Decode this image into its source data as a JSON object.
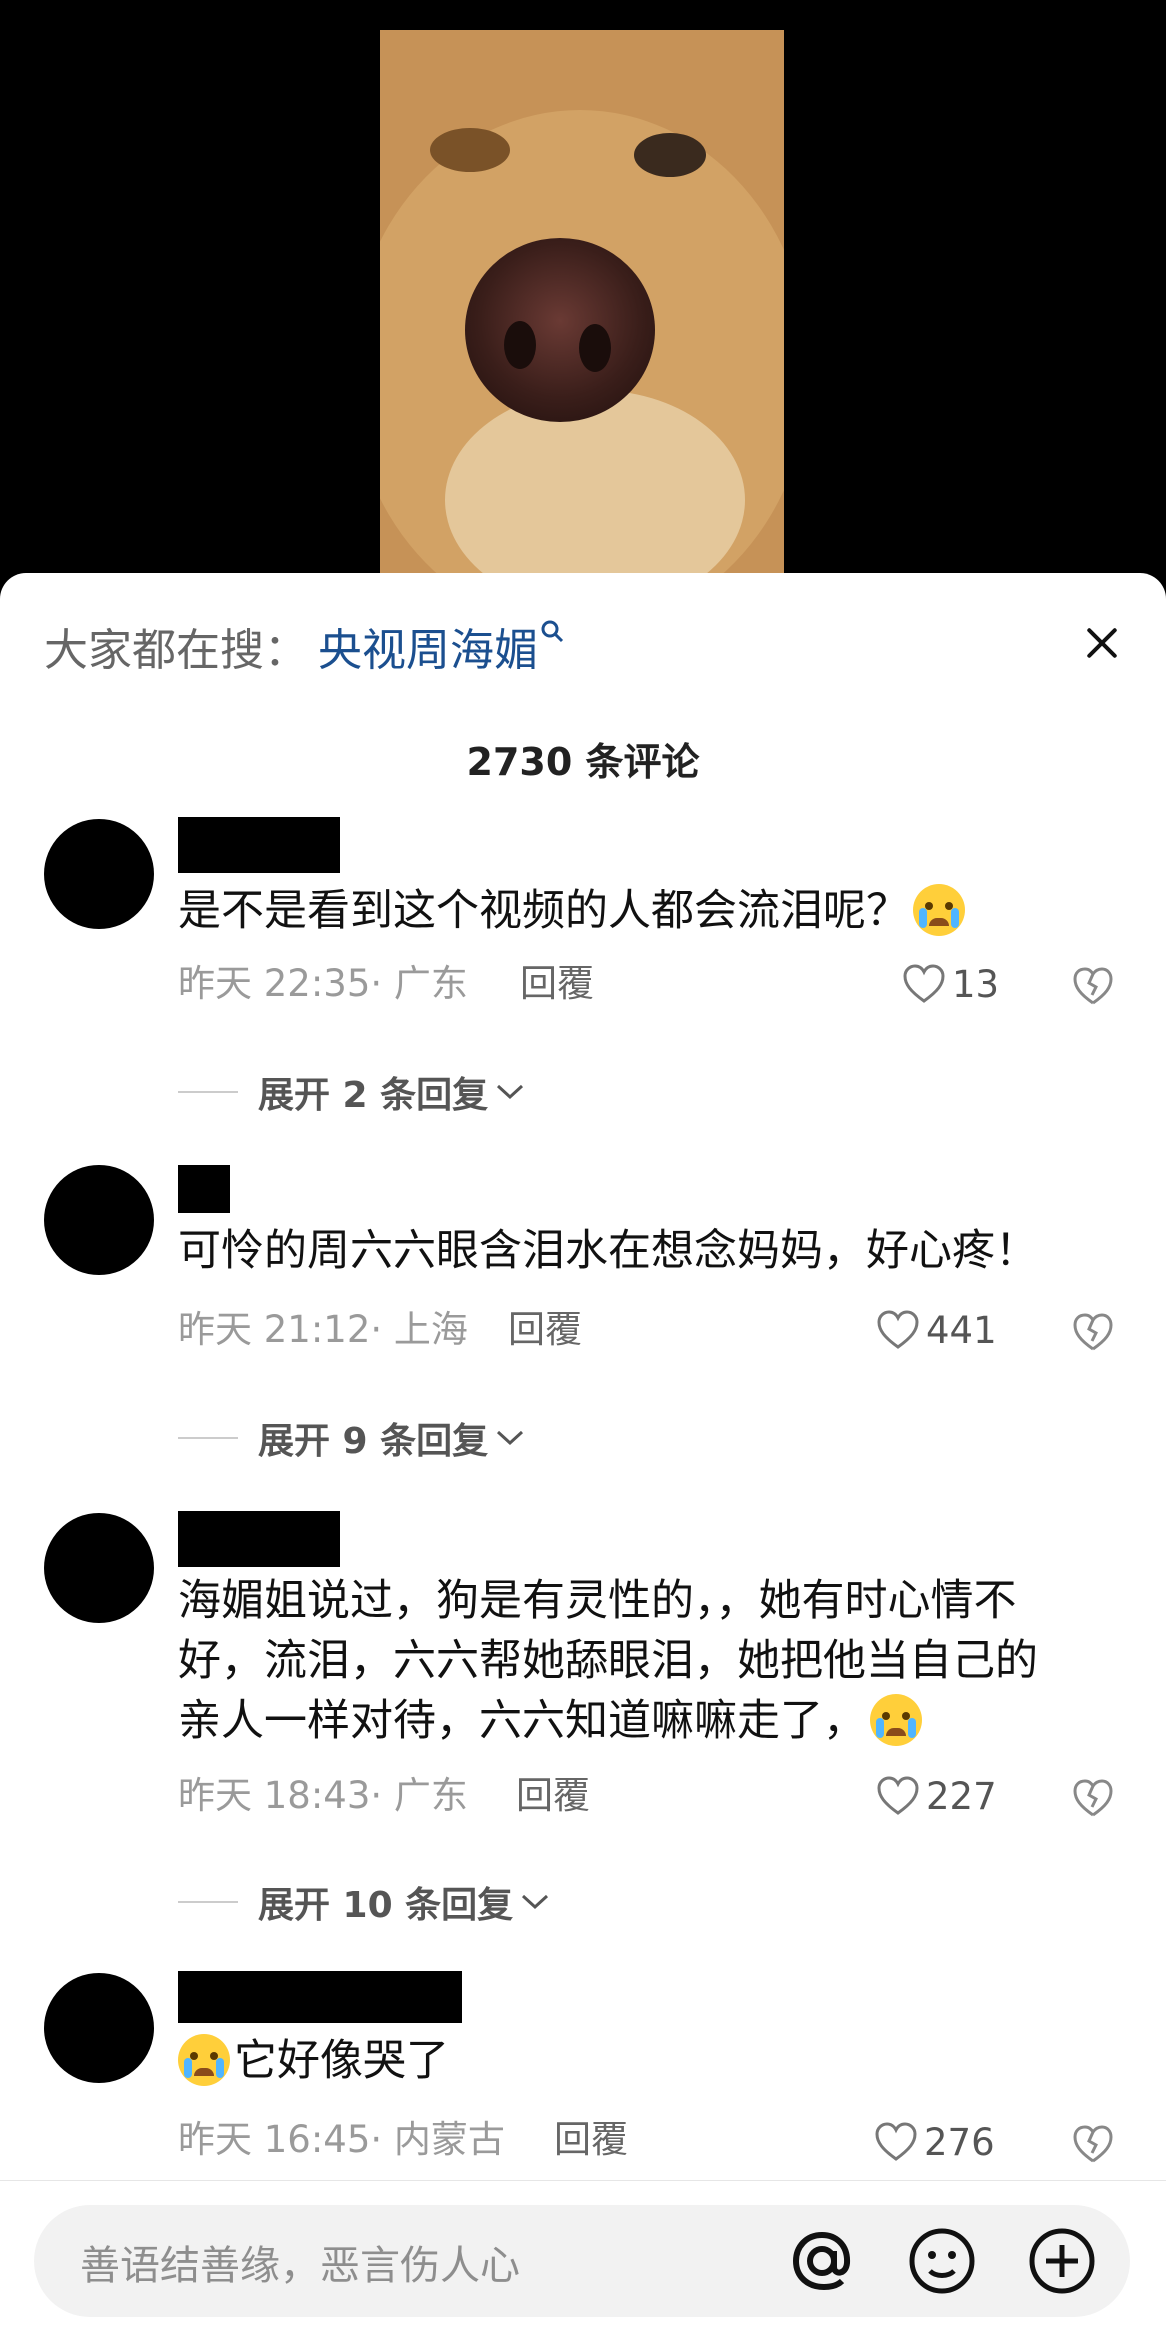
{
  "search": {
    "prefix": "大家都在搜：",
    "term": "央视周海媚",
    "mark": "⚲"
  },
  "comment_count": "2730 条评论",
  "comments": [
    {
      "text": "是不是看到这个视频的人都会流泪呢？",
      "emoji": "cry-emoji",
      "time_location": "昨天 22:35· 广东",
      "reply": "回覆",
      "likes": "13",
      "expand": "展开 2 条回复"
    },
    {
      "text": "可怜的周六六眼含泪水在想念妈妈，好心疼！",
      "time_location": "昨天 21:12· 上海",
      "reply": "回覆",
      "likes": "441",
      "expand": "展开 9 条回复"
    },
    {
      "text_lines": [
        "海媚姐说过，狗是有灵性的，，她有时心情不",
        "好，流泪，六六帮她舔眼泪，她把他当自己的",
        "亲人一样对待，六六知道嘛嘛走了，"
      ],
      "emoji": "loudly-crying-emoji",
      "time_location": "昨天 18:43· 广东",
      "reply": "回覆",
      "likes": "227",
      "expand": "展开 10 条回复"
    },
    {
      "emoji": "loudly-crying-emoji",
      "text": "它好像哭了",
      "time_location": "昨天 16:45· 内蒙古",
      "reply": "回覆",
      "likes": "276"
    }
  ],
  "input": {
    "placeholder": "善语结善缘，恶言伤人心"
  },
  "icons": [
    "close-icon",
    "heart-icon",
    "broken-heart-icon",
    "chevron-down-icon",
    "at-icon",
    "emoji-smile-icon",
    "plus-circle-icon"
  ]
}
